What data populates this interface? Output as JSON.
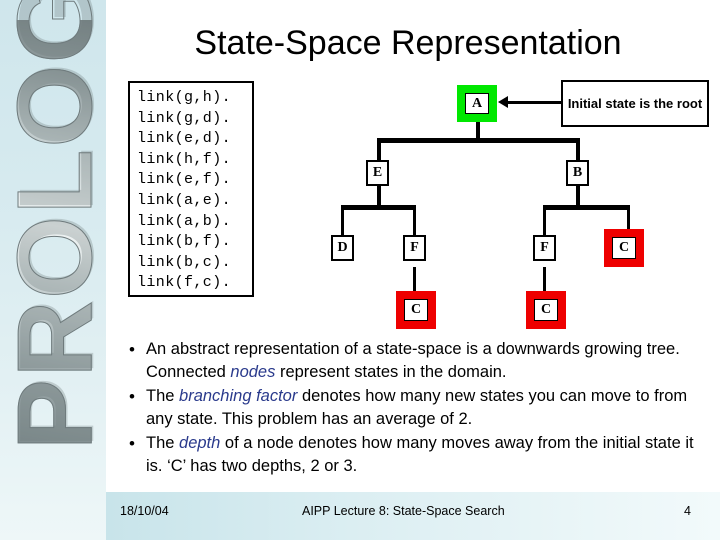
{
  "sidebar": {
    "word": "PROLOG"
  },
  "slide": {
    "title": "State-Space Representation"
  },
  "code": {
    "lines": [
      "link(g,h).",
      "link(g,d).",
      "link(e,d).",
      "link(h,f).",
      "link(e,f).",
      "link(a,e).",
      "link(a,b).",
      "link(b,f).",
      "link(b,c).",
      "link(f,c)."
    ]
  },
  "tree": {
    "nodes": [
      {
        "id": "a",
        "label": "A",
        "highlight": "green"
      },
      {
        "id": "e",
        "label": "E",
        "highlight": "none"
      },
      {
        "id": "b",
        "label": "B",
        "highlight": "none"
      },
      {
        "id": "d",
        "label": "D",
        "highlight": "none"
      },
      {
        "id": "f1",
        "label": "F",
        "highlight": "none"
      },
      {
        "id": "f2",
        "label": "F",
        "highlight": "none"
      },
      {
        "id": "c1",
        "label": "C",
        "highlight": "red"
      },
      {
        "id": "c2",
        "label": "C",
        "highlight": "red"
      },
      {
        "id": "c3",
        "label": "C",
        "highlight": "red"
      }
    ],
    "edges": [
      "a-e",
      "a-b",
      "e-d",
      "e-f1",
      "f1-c2",
      "b-f2",
      "b-c1",
      "f2-c3"
    ],
    "colors": {
      "initial_state": "#00e800",
      "goal_state": "#ee0000",
      "edge": "#000000"
    }
  },
  "callout": {
    "text": "Initial state is the root"
  },
  "bullets": [
    {
      "marker": "•",
      "parts": [
        {
          "text": "An abstract representation of a state-space is a downwards growing tree. Connected ",
          "emphasis": false
        },
        {
          "text": "nodes",
          "emphasis": true
        },
        {
          "text": " represent states in the domain.",
          "emphasis": false
        }
      ]
    },
    {
      "marker": "•",
      "parts": [
        {
          "text": "The ",
          "emphasis": false
        },
        {
          "text": "branching factor",
          "emphasis": true
        },
        {
          "text": " denotes how many new states you can move to from any state. This problem has an average of 2.",
          "emphasis": false
        }
      ]
    },
    {
      "marker": "•",
      "parts": [
        {
          "text": "The ",
          "emphasis": false
        },
        {
          "text": "depth",
          "emphasis": true
        },
        {
          "text": " of a node denotes how many moves away from the initial state it is. ‘C’ has two depths, 2 or 3.",
          "emphasis": false
        }
      ]
    }
  ],
  "footer": {
    "date": "18/10/04",
    "title": "AIPP Lecture 8: State-Space Search",
    "page": "4"
  }
}
